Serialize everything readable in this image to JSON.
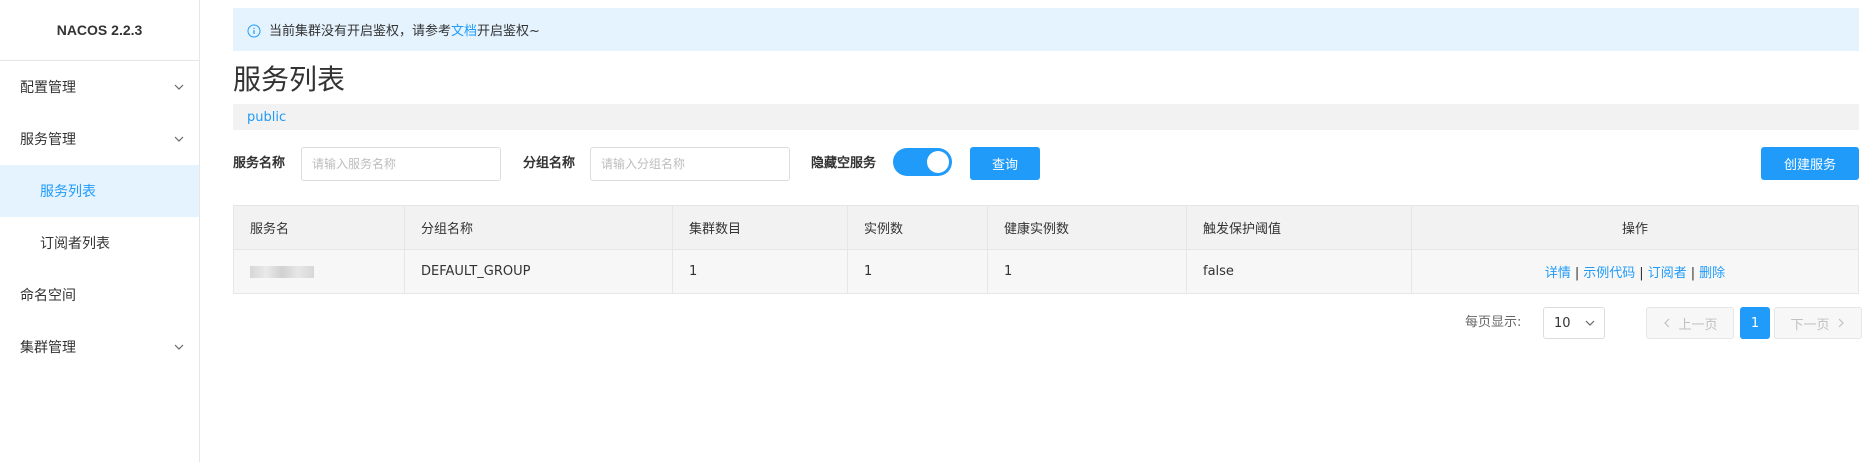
{
  "app": {
    "brand": "NACOS 2.2.3"
  },
  "sidebar": {
    "items": [
      {
        "label": "配置管理",
        "expandable": true
      },
      {
        "label": "服务管理",
        "expandable": true
      },
      {
        "label": "服务列表",
        "active": true
      },
      {
        "label": "订阅者列表"
      },
      {
        "label": "命名空间"
      },
      {
        "label": "集群管理",
        "expandable": true
      }
    ]
  },
  "notice": {
    "prefix": "当前集群没有开启鉴权，请参考",
    "link": "文档",
    "suffix": "开启鉴权~"
  },
  "page": {
    "title": "服务列表",
    "namespace": "public"
  },
  "filters": {
    "service_name_label": "服务名称",
    "service_name_placeholder": "请输入服务名称",
    "group_name_label": "分组名称",
    "group_name_placeholder": "请输入分组名称",
    "hide_empty_label": "隐藏空服务",
    "hide_empty_on": true,
    "query_button": "查询",
    "create_button": "创建服务"
  },
  "table": {
    "columns": [
      "服务名",
      "分组名称",
      "集群数目",
      "实例数",
      "健康实例数",
      "触发保护阈值",
      "操作"
    ],
    "rows": [
      {
        "group": "DEFAULT_GROUP",
        "clusters": "1",
        "instances": "1",
        "healthy": "1",
        "threshold": "false"
      }
    ],
    "actions": [
      "详情",
      "示例代码",
      "订阅者",
      "删除"
    ]
  },
  "pagination": {
    "page_size_label": "每页显示:",
    "page_size": "10",
    "prev": "上一页",
    "current": "1",
    "next": "下一页"
  },
  "colors": {
    "accent": "#209bfa",
    "notice_bg": "#e4f3fe"
  }
}
